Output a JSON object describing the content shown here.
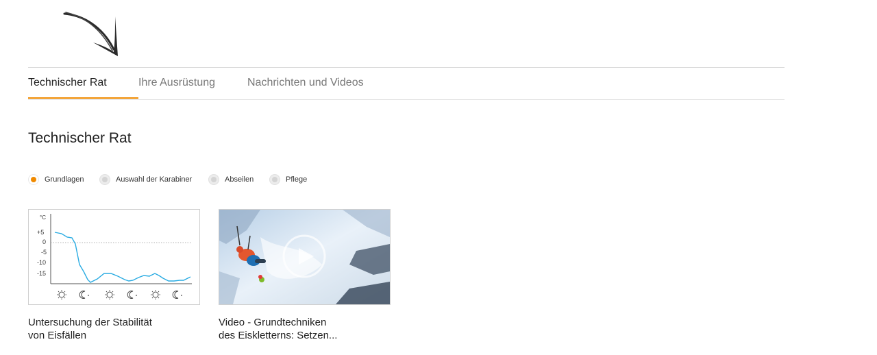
{
  "tabs": [
    {
      "label": "Technischer Rat",
      "active": true
    },
    {
      "label": "Ihre Ausrüstung",
      "active": false
    },
    {
      "label": "Nachrichten und Videos",
      "active": false
    }
  ],
  "section_title": "Technischer Rat",
  "filters": [
    {
      "label": "Grundlagen",
      "selected": true
    },
    {
      "label": "Auswahl der Karabiner",
      "selected": false
    },
    {
      "label": "Abseilen",
      "selected": false
    },
    {
      "label": "Pflege",
      "selected": false
    }
  ],
  "cards": [
    {
      "title_line1": "Untersuchung der Stabilität",
      "title_line2": "von Eisfällen",
      "thumbnail": {
        "unit": "°C",
        "y_ticks": [
          "+5",
          "0",
          "-5",
          "-10",
          "-15"
        ],
        "icons": [
          "sun-icon",
          "moon-icon",
          "sun-icon",
          "moon-icon",
          "sun-icon",
          "moon-icon"
        ]
      }
    },
    {
      "title_line1": "Video - Grundtechniken",
      "title_line2": "des Eiskletterns: Setzen...",
      "thumbnail": {
        "icon": "play-icon"
      }
    }
  ],
  "colors": {
    "accent": "#f08a00",
    "chart_line": "#29abe2"
  }
}
